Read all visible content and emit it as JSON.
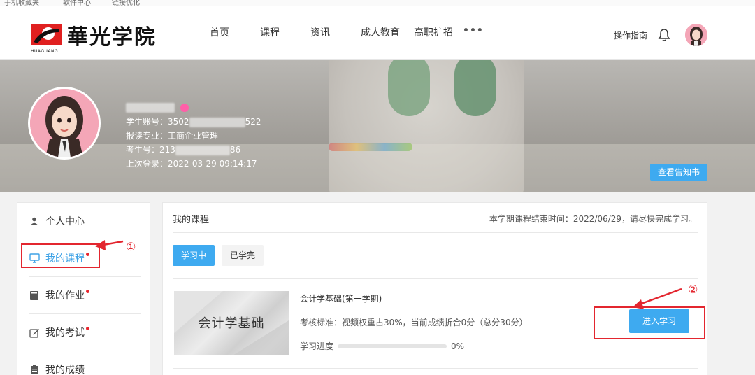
{
  "bookmarks": [
    "手机收藏夹",
    "软件中心",
    "链接优化"
  ],
  "header": {
    "logo_text": "華光学院",
    "logo_sub": "HUAGUANG",
    "nav": [
      "首页",
      "课程",
      "资讯",
      "成人教育",
      "高职扩招"
    ],
    "nav_more": "•••",
    "guide": "操作指南"
  },
  "profile": {
    "account_label": "学生账号：",
    "account_prefix": "3502",
    "account_suffix": "522",
    "major_label": "报读专业：",
    "major": "工商企业管理",
    "exam_label": "考生号：",
    "exam_prefix": "213",
    "exam_suffix": "86",
    "last_login_label": "上次登录：",
    "last_login": "2022-03-29 09:14:17",
    "notice_button": "查看告知书"
  },
  "sidebar": {
    "items": [
      {
        "label": "个人中心",
        "icon": "user-icon"
      },
      {
        "label": "我的课程",
        "icon": "monitor-icon"
      },
      {
        "label": "我的作业",
        "icon": "book-icon"
      },
      {
        "label": "我的考试",
        "icon": "edit-icon"
      },
      {
        "label": "我的成绩",
        "icon": "grade-icon"
      }
    ]
  },
  "main": {
    "title": "我的课程",
    "notice": "本学期课程结束时间：2022/06/29，请尽快完成学习。",
    "tabs": [
      "学习中",
      "已学完"
    ],
    "course": {
      "cover_text": "会计学基础",
      "name": "会计学基础(第一学期)",
      "standard": "考核标准：视频权重占30%，当前成绩折合0分（总分30分）",
      "progress_label": "学习进度",
      "progress_value": "0%",
      "progress_fraction": 0,
      "enter_button": "进入学习"
    }
  },
  "annotations": {
    "one": "①",
    "two": "②"
  },
  "colors": {
    "accent": "#3eaaf0",
    "annotation": "#e3262f",
    "dot": "#e8262e"
  }
}
